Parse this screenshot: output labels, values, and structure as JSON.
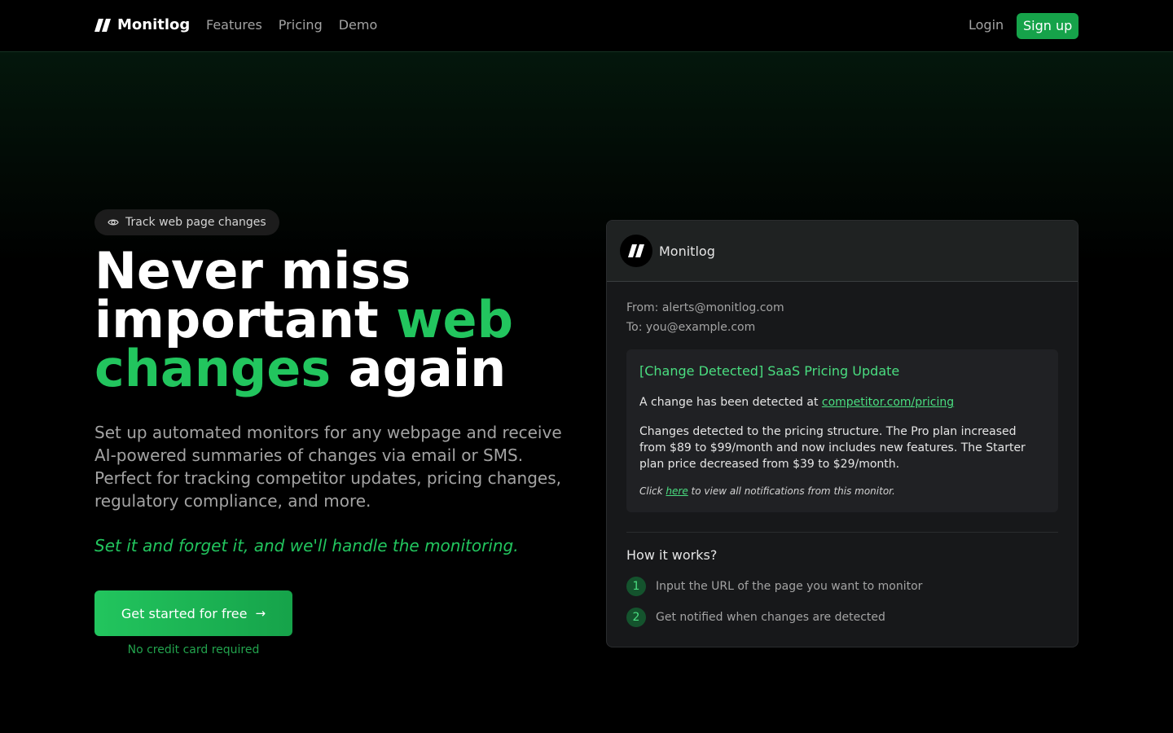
{
  "nav": {
    "brand": "Monitlog",
    "links": [
      "Features",
      "Pricing",
      "Demo"
    ],
    "login": "Login",
    "signup": "Sign up"
  },
  "hero": {
    "badge": "Track web page changes",
    "headline": {
      "part1": "Never miss important ",
      "highlight1": "web",
      "highlight2": "changes",
      "part2": " again"
    },
    "description": "Set up automated monitors for any webpage and receive AI-powered summaries of changes via email or SMS. Perfect for tracking competitor updates, pricing changes, regulatory compliance, and more.",
    "tagline": "Set it and forget it, and we'll handle the monitoring.",
    "cta": "Get started for free",
    "cta_arrow": "→",
    "cta_note": "No credit card required"
  },
  "preview": {
    "sender_name": "Monitlog",
    "from": "From: alerts@monitlog.com",
    "to": "To: you@example.com",
    "subject": "[Change Detected] SaaS Pricing Update",
    "detected_prefix": "A change has been detected at ",
    "detected_link": "competitor.com/pricing",
    "summary": "Changes detected to the pricing structure. The Pro plan increased from $89 to $99/month and now includes new features. The Starter plan price decreased from $39 to $29/month.",
    "click_prefix": "Click ",
    "click_link": "here",
    "click_suffix": " to view all notifications from this monitor.",
    "how_title": "How it works?",
    "steps": [
      {
        "num": "1",
        "text": "Input the URL of the page you want to monitor"
      },
      {
        "num": "2",
        "text": "Get notified when changes are detected"
      }
    ]
  },
  "colors": {
    "accent": "#22c55e",
    "accent_dark": "#16a34a",
    "background": "#000000",
    "card": "#17181a"
  },
  "icons": [
    "logo-mark-icon",
    "eye-icon",
    "arrow-right-icon"
  ]
}
